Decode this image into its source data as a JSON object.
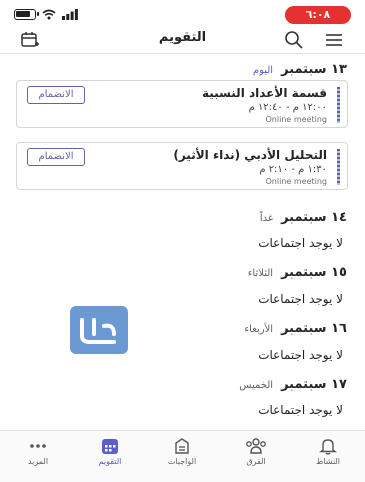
{
  "status_bar": {
    "time": "٦:٠٨",
    "battery_level": 0.8
  },
  "header": {
    "title": "التقويم"
  },
  "days": [
    {
      "date": "١٣ سبتمبر",
      "sub": "اليوم",
      "events": [
        {
          "title": "قسمة الأعداد النسبية",
          "time": "١٢:٠٠ م - ١٢:٤٠ م",
          "type": "Online meeting",
          "join_label": "الانضمام"
        },
        {
          "title": "التحليل الأدبي (نداء الأثير)",
          "time": "١:٣٠ م - ٢:١٠ م",
          "type": "Online meeting",
          "join_label": "الانضمام"
        }
      ]
    },
    {
      "date": "١٤ سبتمبر",
      "sub": "غداً",
      "empty": "لا يوجد اجتماعات"
    },
    {
      "date": "١٥ سبتمبر",
      "sub": "الثلاثاء",
      "empty": "لا يوجد اجتماعات"
    },
    {
      "date": "١٦ سبتمبر",
      "sub": "الأربعاء",
      "empty": "لا يوجد اجتماعات"
    },
    {
      "date": "١٧ سبتمبر",
      "sub": "الخميس",
      "empty": "لا يوجد اجتماعات"
    }
  ],
  "nav": [
    {
      "label": "النشاط",
      "icon": "bell-icon"
    },
    {
      "label": "الفرق",
      "icon": "teams-icon"
    },
    {
      "label": "الواجبات",
      "icon": "assignments-icon"
    },
    {
      "label": "التقويم",
      "icon": "calendar-icon",
      "active": true
    },
    {
      "label": "المزيد",
      "icon": "more-icon"
    }
  ],
  "colors": {
    "accent": "#5b5fc7",
    "status_time_bg": "#e5312f"
  }
}
